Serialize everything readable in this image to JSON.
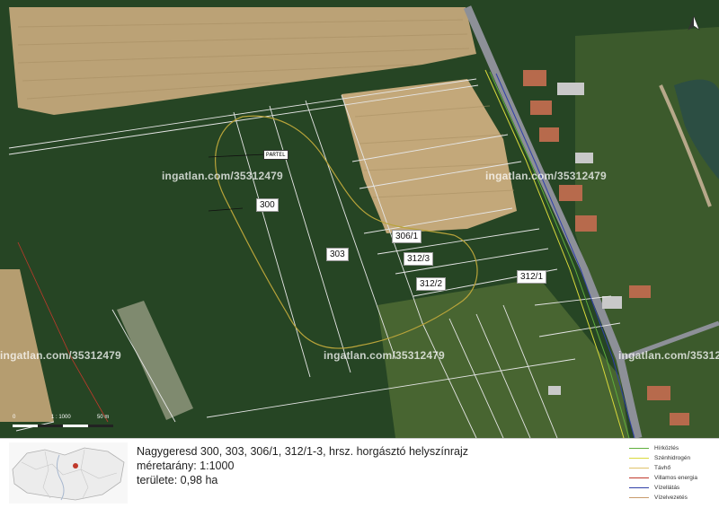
{
  "map": {
    "parcels": [
      "300",
      "303",
      "306/1",
      "312/3",
      "312/2",
      "312/1"
    ],
    "callout": "PARTEL",
    "watermarks": [
      "ingatlan.com/35312479",
      "ingatlan.com/35312479",
      "ingatlan.com/35312479",
      "ingatlan.com/35312479",
      "ingatlan.com/35312479"
    ],
    "north_icon": "north-arrow-icon",
    "scale": {
      "start": "0",
      "ratio": "1 : 1000",
      "end": "50 m"
    }
  },
  "footer": {
    "title": "Nagygeresd 300, 303, 306/1, 312/1-3, hrsz. horgásztó helyszínrajz",
    "scale_line": "méretarány: 1:1000",
    "area_line": "területe: 0,98 ha"
  },
  "legend": [
    {
      "label": "Hírközlés",
      "color": "#5fae3c"
    },
    {
      "label": "Szénhidrogén",
      "color": "#d9d93a"
    },
    {
      "label": "Távhő",
      "color": "#e0c36a"
    },
    {
      "label": "Villamos energia",
      "color": "#c0392b"
    },
    {
      "label": "Vízellátás",
      "color": "#2f3fa8"
    },
    {
      "label": "Vízelvezetés",
      "color": "#c89a6a"
    }
  ],
  "colors": {
    "forest": "#1f3d1c",
    "field": "#b9a074",
    "meadow": "#5d7a3e",
    "road": "#8d9098",
    "parcel_lines": "#e6e6e6",
    "lake_outline": "#b9a43a"
  }
}
